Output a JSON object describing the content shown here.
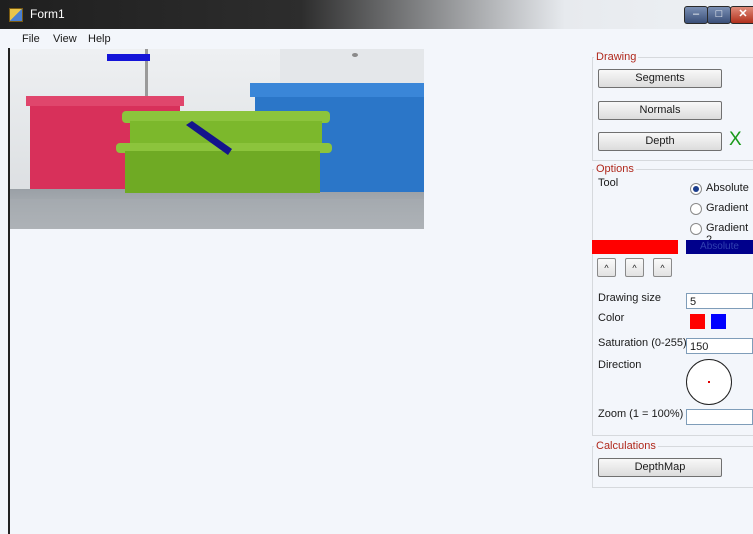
{
  "window": {
    "title": "Form1"
  },
  "menu": {
    "items": [
      "File",
      "View",
      "Help"
    ]
  },
  "drawing": {
    "group_label": "Drawing",
    "segments_label": "Segments",
    "normals_label": "Normals",
    "depth_label": "Depth",
    "depth_status": "X",
    "status_color": "#1a9a1a"
  },
  "options": {
    "group_label": "Options",
    "tool_label": "Tool",
    "radios": [
      {
        "label": "Absolute",
        "checked": true
      },
      {
        "label": "Gradient",
        "checked": false
      },
      {
        "label": "Gradient 2",
        "checked": false
      }
    ],
    "mode_bar_label": "Absolute",
    "primary_color": "#ff0000",
    "secondary_color": "#0000ff",
    "mode_bar_color": "#00008b",
    "drawing_size_label": "Drawing size",
    "drawing_size_value": "5",
    "color_label": "Color",
    "saturation_label": "Saturation (0-255)",
    "saturation_value": "150",
    "direction_label": "Direction",
    "zoom_label": "Zoom (1 = 100%)",
    "zoom_value": ""
  },
  "calculations": {
    "group_label": "Calculations",
    "depthmap_label": "DepthMap"
  }
}
